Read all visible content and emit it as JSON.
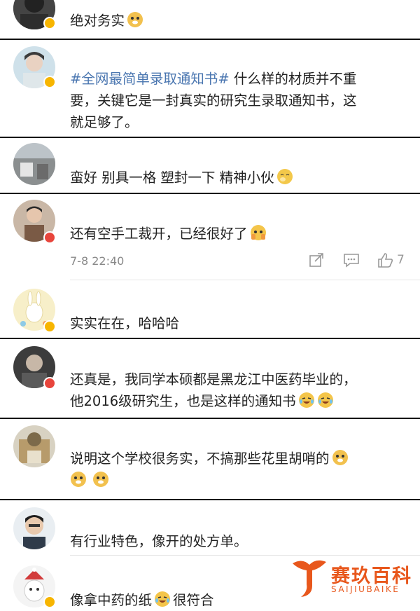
{
  "comments": [
    {
      "text": "绝对务实"
    },
    {
      "tag": "#全网最简单录取通知书#",
      "line1": "什么样的材质并不重",
      "line2": "要，关键它是一封真实的研究生录取通知书，这",
      "line3": "就足够了。"
    },
    {
      "text": "蛮好 别具一格 塑封一下 精神小伙"
    },
    {
      "text": "还有空手工裁开，已经很好了",
      "time": "7-8 22:40",
      "likes": "7"
    },
    {
      "text": "实实在在，哈哈哈"
    },
    {
      "line1": "还真是，我同学本硕都是黑龙江中医药毕业的，",
      "line2": "他2016级研究生，也是这样的通知书"
    },
    {
      "text": "说明这个学校很务实，不搞那些花里胡哨的"
    },
    {
      "text": "有行业特色，像开的处方单。"
    },
    {
      "text_a": "像拿中药的纸",
      "text_b": "很符合"
    }
  ],
  "watermark": {
    "title": "赛玖百科",
    "subtitle": "SAIJIUBAIKE"
  },
  "icons": {
    "share": "share-icon",
    "comment": "comment-icon",
    "like": "thumb-up-icon"
  },
  "colors": {
    "tag": "#4a76b0",
    "badge_verified": "#f7b500",
    "badge_red": "#e8453c",
    "watermark": "#e8571c"
  }
}
